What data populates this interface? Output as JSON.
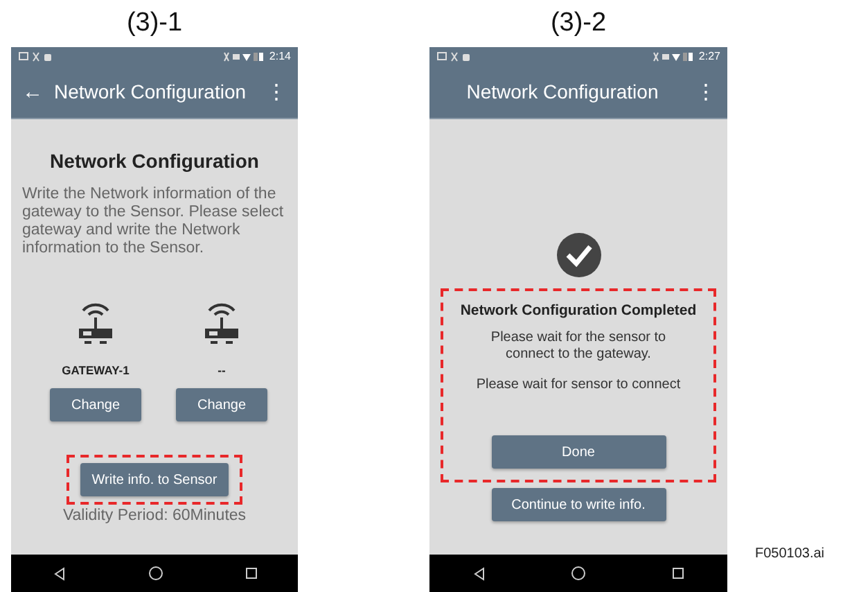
{
  "screens": [
    {
      "kind": "write",
      "caption": "(3)-1",
      "status_time": "2:14",
      "app_bar": {
        "back": "←",
        "title": "Network Configuration",
        "menu": "⋮"
      },
      "heading": "Network Configuration",
      "description": "Write the Network information of the gateway to the Sensor. Please select gateway and write the Network information to the Sensor.",
      "gateways": [
        {
          "name": "GATEWAY-1",
          "button": "Change"
        },
        {
          "name": "--",
          "button": "Change"
        }
      ],
      "action": {
        "label": "Write info. to Sensor",
        "highlighted": true
      },
      "validity": "Validity Period: 60Minutes"
    },
    {
      "kind": "completed",
      "caption": "(3)-2",
      "status_time": "2:27",
      "app_bar": {
        "title": "Network Configuration",
        "menu": "⋮"
      },
      "panel": {
        "highlighted": true,
        "heading": "Network Configuration Completed",
        "message": "Please wait for the sensor to connect to the gateway.",
        "note": "Please wait for sensor to connect",
        "button": "Done"
      },
      "secondary_button": "Continue to write info."
    }
  ],
  "figure_id": "F050103.ai"
}
